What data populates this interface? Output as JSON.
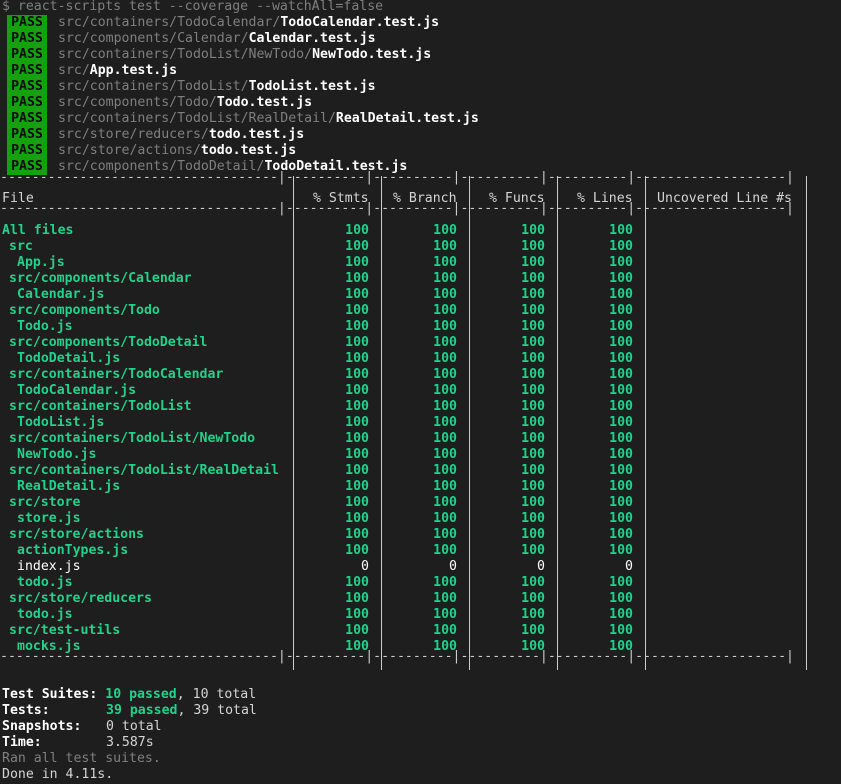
{
  "command": "$ react-scripts test --coverage --watchAll=false",
  "suites": [
    {
      "badge": "PASS",
      "dir": "src/containers/TodoCalendar/",
      "file": "TodoCalendar.test.js"
    },
    {
      "badge": "PASS",
      "dir": "src/components/Calendar/",
      "file": "Calendar.test.js"
    },
    {
      "badge": "PASS",
      "dir": "src/containers/TodoList/NewTodo/",
      "file": "NewTodo.test.js"
    },
    {
      "badge": "PASS",
      "dir": "src/",
      "file": "App.test.js"
    },
    {
      "badge": "PASS",
      "dir": "src/containers/TodoList/",
      "file": "TodoList.test.js"
    },
    {
      "badge": "PASS",
      "dir": "src/components/Todo/",
      "file": "Todo.test.js"
    },
    {
      "badge": "PASS",
      "dir": "src/containers/TodoList/RealDetail/",
      "file": "RealDetail.test.js"
    },
    {
      "badge": "PASS",
      "dir": "src/store/reducers/",
      "file": "todo.test.js"
    },
    {
      "badge": "PASS",
      "dir": "src/store/actions/",
      "file": "todo.test.js"
    },
    {
      "badge": "PASS",
      "dir": "src/components/TodoDetail/",
      "file": "TodoDetail.test.js"
    }
  ],
  "table": {
    "dash_row": "-----------------------------------|----------|----------|----------|----------|-------------------|",
    "headers": [
      "File",
      "% Stmts",
      "% Branch",
      "% Funcs",
      "% Lines",
      "Uncovered Line #s"
    ],
    "rows": [
      {
        "name": "All files",
        "indent": 0,
        "v": [
          "100",
          "100",
          "100",
          "100"
        ],
        "covered": true
      },
      {
        "name": "src",
        "indent": 1,
        "v": [
          "100",
          "100",
          "100",
          "100"
        ],
        "covered": true
      },
      {
        "name": "App.js",
        "indent": 2,
        "v": [
          "100",
          "100",
          "100",
          "100"
        ],
        "covered": true
      },
      {
        "name": "src/components/Calendar",
        "indent": 1,
        "v": [
          "100",
          "100",
          "100",
          "100"
        ],
        "covered": true
      },
      {
        "name": "Calendar.js",
        "indent": 2,
        "v": [
          "100",
          "100",
          "100",
          "100"
        ],
        "covered": true
      },
      {
        "name": "src/components/Todo",
        "indent": 1,
        "v": [
          "100",
          "100",
          "100",
          "100"
        ],
        "covered": true
      },
      {
        "name": "Todo.js",
        "indent": 2,
        "v": [
          "100",
          "100",
          "100",
          "100"
        ],
        "covered": true
      },
      {
        "name": "src/components/TodoDetail",
        "indent": 1,
        "v": [
          "100",
          "100",
          "100",
          "100"
        ],
        "covered": true
      },
      {
        "name": "TodoDetail.js",
        "indent": 2,
        "v": [
          "100",
          "100",
          "100",
          "100"
        ],
        "covered": true
      },
      {
        "name": "src/containers/TodoCalendar",
        "indent": 1,
        "v": [
          "100",
          "100",
          "100",
          "100"
        ],
        "covered": true
      },
      {
        "name": "TodoCalendar.js",
        "indent": 2,
        "v": [
          "100",
          "100",
          "100",
          "100"
        ],
        "covered": true
      },
      {
        "name": "src/containers/TodoList",
        "indent": 1,
        "v": [
          "100",
          "100",
          "100",
          "100"
        ],
        "covered": true
      },
      {
        "name": "TodoList.js",
        "indent": 2,
        "v": [
          "100",
          "100",
          "100",
          "100"
        ],
        "covered": true
      },
      {
        "name": "src/containers/TodoList/NewTodo",
        "indent": 1,
        "v": [
          "100",
          "100",
          "100",
          "100"
        ],
        "covered": true
      },
      {
        "name": "NewTodo.js",
        "indent": 2,
        "v": [
          "100",
          "100",
          "100",
          "100"
        ],
        "covered": true
      },
      {
        "name": "src/containers/TodoList/RealDetail",
        "indent": 1,
        "v": [
          "100",
          "100",
          "100",
          "100"
        ],
        "covered": true
      },
      {
        "name": "RealDetail.js",
        "indent": 2,
        "v": [
          "100",
          "100",
          "100",
          "100"
        ],
        "covered": true
      },
      {
        "name": "src/store",
        "indent": 1,
        "v": [
          "100",
          "100",
          "100",
          "100"
        ],
        "covered": true
      },
      {
        "name": "store.js",
        "indent": 2,
        "v": [
          "100",
          "100",
          "100",
          "100"
        ],
        "covered": true
      },
      {
        "name": "src/store/actions",
        "indent": 1,
        "v": [
          "100",
          "100",
          "100",
          "100"
        ],
        "covered": true
      },
      {
        "name": "actionTypes.js",
        "indent": 2,
        "v": [
          "100",
          "100",
          "100",
          "100"
        ],
        "covered": true
      },
      {
        "name": "index.js",
        "indent": 2,
        "v": [
          "0",
          "0",
          "0",
          "0"
        ],
        "covered": false
      },
      {
        "name": "todo.js",
        "indent": 2,
        "v": [
          "100",
          "100",
          "100",
          "100"
        ],
        "covered": true
      },
      {
        "name": "src/store/reducers",
        "indent": 1,
        "v": [
          "100",
          "100",
          "100",
          "100"
        ],
        "covered": true
      },
      {
        "name": "todo.js",
        "indent": 2,
        "v": [
          "100",
          "100",
          "100",
          "100"
        ],
        "covered": true
      },
      {
        "name": "src/test-utils",
        "indent": 1,
        "v": [
          "100",
          "100",
          "100",
          "100"
        ],
        "covered": true
      },
      {
        "name": "mocks.js",
        "indent": 2,
        "v": [
          "100",
          "100",
          "100",
          "100"
        ],
        "covered": true
      }
    ]
  },
  "summary": {
    "suites_label": "Test Suites:",
    "suites_passed": "10 passed",
    "suites_total": ", 10 total",
    "tests_label": "Tests:",
    "tests_passed": "39 passed",
    "tests_total": ", 39 total",
    "snapshots_label": "Snapshots:",
    "snapshots_value": "0 total",
    "time_label": "Time:",
    "time_value": "3.587s",
    "ran_all": "Ran all test suites.",
    "done": "Done in 4.11s."
  },
  "colors": {
    "pass_badge": "#13a10e",
    "covered": "#23d18b",
    "background": "#1e1e1e"
  }
}
